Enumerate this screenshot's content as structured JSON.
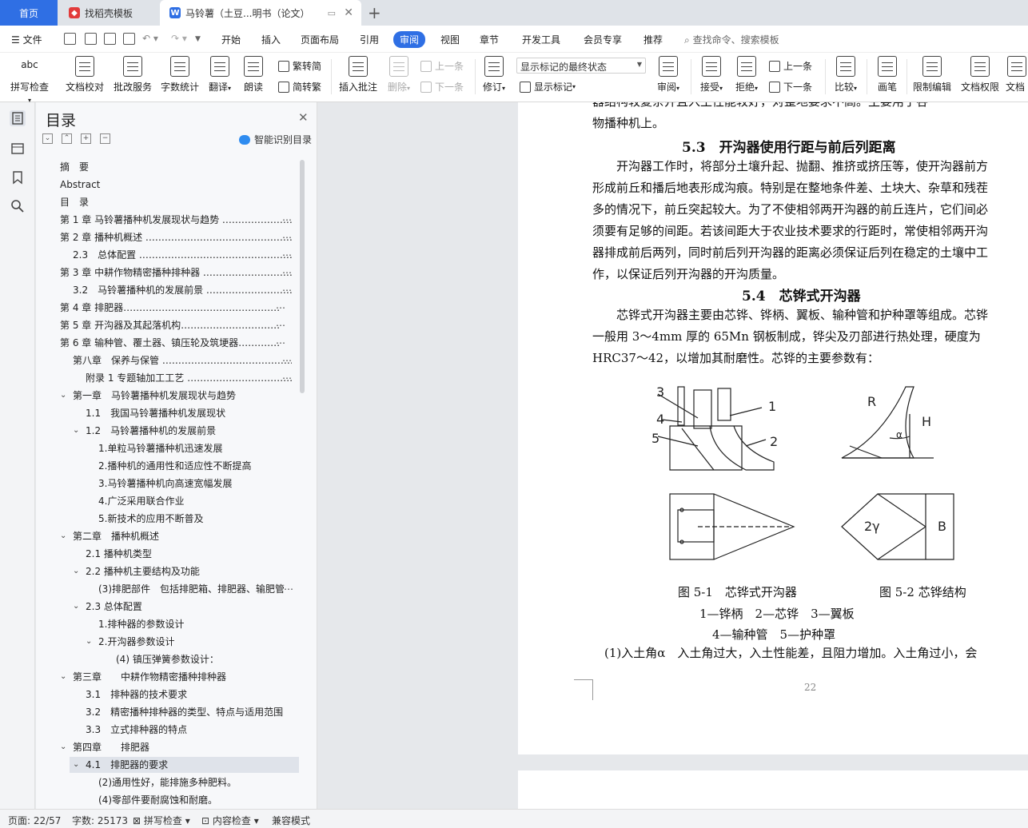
{
  "tabs": {
    "home": "首页",
    "template": "找稻壳模板",
    "doc": "马铃薯（土豆...明书（论文）",
    "add": "+"
  },
  "menu": {
    "file": "文件",
    "items": [
      "开始",
      "插入",
      "页面布局",
      "引用",
      "审阅",
      "视图",
      "章节",
      "开发工具",
      "会员专享",
      "推荐"
    ],
    "search": "查找命令、搜索模板"
  },
  "ribbon": {
    "spell": "拼写检查",
    "spell_icon_text": "abc",
    "proof": "文档校对",
    "batch": "批改服务",
    "wordcount": "字数统计",
    "translate": "翻译",
    "read": "朗读",
    "trad": "繁转简",
    "simp": "简转繁",
    "insert_comment": "插入批注",
    "delete": "删除",
    "prev": "上一条",
    "next": "下一条",
    "track": "修订",
    "markup_state": "显示标记的最终状态",
    "show_markup": "显示标记",
    "review": "审阅",
    "accept": "接受",
    "reject": "拒绝",
    "prev2": "上一条",
    "next2": "下一条",
    "compare": "比较",
    "ink": "画笔",
    "restrict": "限制编辑",
    "perm": "文档权限",
    "more": "文档"
  },
  "toc": {
    "title": "目录",
    "smart": "智能识别目录",
    "items": [
      {
        "text": "摘　要"
      },
      {
        "text": "Abstract"
      },
      {
        "text": "目　录"
      },
      {
        "text": "第 1 章  马铃薯播种机发展现状与趋势 ……………………………"
      },
      {
        "text": "第 2 章  播种机概述 ……………………………………………………"
      },
      {
        "text": "2.3　总体配置 ………………………………………………………"
      },
      {
        "text": "第 3 章  中耕作物精密播种排种器 ………………………………"
      },
      {
        "text": "3.2　马铃薯播种机的发展前景 ……………………………………"
      },
      {
        "text": "第 4 章  排肥器…………………………………………………………"
      },
      {
        "text": "第 5 章  开沟器及其起落机构……………………………………"
      },
      {
        "text": "第 6 章  输种管、覆土器、镇压轮及筑埂器…………………"
      },
      {
        "text": "第八章　保养与保管 ………………………………………………"
      },
      {
        "text": "附录 1 专题轴加工工艺 …………………………………………"
      },
      {
        "text": "第一章　马铃薯播种机发展现状与趋势"
      },
      {
        "text": "1.1　我国马铃薯播种机发展现状"
      },
      {
        "text": "1.2　马铃薯播种机的发展前景"
      },
      {
        "text": "1.单粒马铃薯播种机迅速发展"
      },
      {
        "text": "2.播种机的通用性和适应性不断提高"
      },
      {
        "text": "3.马铃薯播种机向高速宽幅发展"
      },
      {
        "text": "4.广泛采用联合作业"
      },
      {
        "text": "5.新技术的应用不断普及"
      },
      {
        "text": "第二章　播种机概述"
      },
      {
        "text": "2.1  播种机类型"
      },
      {
        "text": "2.2  播种机主要结构及功能"
      },
      {
        "text": "(3)排肥部件　包括排肥箱、排肥器、输肥管"
      },
      {
        "text": "2.3  总体配置"
      },
      {
        "text": "1.排种器的参数设计"
      },
      {
        "text": "2.开沟器参数设计"
      },
      {
        "text": "(4)  镇压弹簧参数设计："
      },
      {
        "text": "第三章　　中耕作物精密播种排种器"
      },
      {
        "text": "3.1　排种器的技术要求"
      },
      {
        "text": "3.2　精密播种排种器的类型、特点与适用范围"
      },
      {
        "text": "3.3　立式排种器的特点"
      },
      {
        "text": "第四章　　排肥器"
      },
      {
        "text": "4.1　排肥器的要求"
      },
      {
        "text": "(2)通用性好，能排施多种肥料。"
      },
      {
        "text": "(4)零部件要耐腐蚀和耐磨。"
      }
    ]
  },
  "doc": {
    "top_partial": "器结构较复杂并且入土性能较好，对整地要求不高。主要用于谷",
    "line0": "物播种机上。",
    "h53": "5.3　开沟器使用行距与前后列距离",
    "p1": [
      "　　开沟器工作时，将部分土壤升起、抛翻、推挤或挤压等，使开沟器前方",
      "形成前丘和播后地表形成沟痕。特别是在整地条件差、土块大、杂草和残茬",
      "多的情况下，前丘突起较大。为了不使相邻两开沟器的前丘连片，它们间必",
      "须要有足够的间距。若该间距大于农业技术要求的行距时，常使相邻两开沟",
      "器排成前后两列，同时前后列开沟器的距离必须保证后列在稳定的土壤中工",
      "作，以保证后列开沟器的开沟质量。"
    ],
    "h54": "5.4　芯铧式开沟器",
    "p2": [
      "　　芯铧式开沟器主要由芯铧、铧柄、翼板、输种管和护种罩等组成。芯铧",
      "一般用 3～4mm 厚的 65Mn 钢板制成，铧尖及刃部进行热处理，硬度为",
      "HRC37～42，以增加其耐磨性。芯铧的主要参数有："
    ],
    "fig_labels": {
      "n1": "1",
      "n2": "2",
      "n3": "3",
      "n4": "4",
      "n5": "5",
      "R": "R",
      "H": "H",
      "a": "α",
      "twoY": "2γ",
      "B": "B"
    },
    "cap1": "图 5-1　芯铧式开沟器",
    "cap2": "图 5-2  芯铧结构",
    "legend1": "1—铧柄　2—芯铧　3—翼板",
    "legend2": "4—输种管　5—护种罩",
    "p3": "　(1)入土角α　入土角过大，入土性能差，且阻力增加。入土角过小，会",
    "page_no": "22"
  },
  "status": {
    "page": "页面: 22/57",
    "words": "字数: 25173",
    "spell": "拼写检查",
    "content": "内容检查",
    "compat": "兼容模式"
  }
}
